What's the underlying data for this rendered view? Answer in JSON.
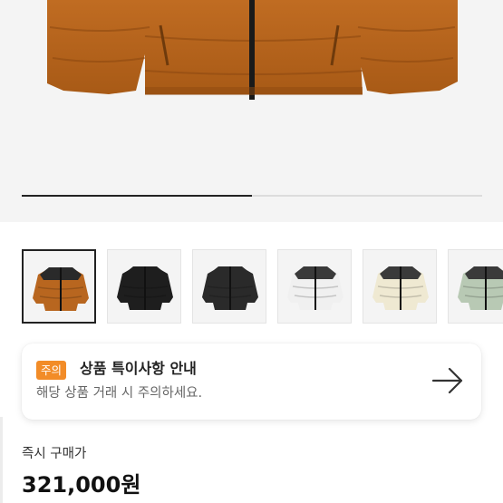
{
  "hero": {
    "image_name": "brown-puffer-jacket-photo",
    "carousel_progress": 0.5
  },
  "thumbnails": [
    {
      "color_name": "brown",
      "body": "#b8661f",
      "shoulder": "#2a2a2a",
      "selected": true
    },
    {
      "color_name": "black",
      "body": "#1e1e1e",
      "shoulder": "#1e1e1e",
      "selected": false
    },
    {
      "color_name": "black-glossy",
      "body": "#2a2a2a",
      "shoulder": "#2a2a2a",
      "selected": false
    },
    {
      "color_name": "white",
      "body": "#f0f0f0",
      "shoulder": "#3a3a3a",
      "selected": false
    },
    {
      "color_name": "cream",
      "body": "#efe9d2",
      "shoulder": "#3a3a3a",
      "selected": false
    },
    {
      "color_name": "sage",
      "body": "#b8c9b4",
      "shoulder": "#3a3a3a",
      "selected": false
    }
  ],
  "notice": {
    "badge": "주의",
    "title": "상품 특이사항 안내",
    "subtitle": "해당 상품 거래 시 주의하세요.",
    "arrow_icon": "arrow-right-icon"
  },
  "price": {
    "label": "즉시 구매가",
    "value": "321,000원"
  },
  "colors": {
    "badge_orange": "#f28c28",
    "jacket_brown": "#b8661f"
  }
}
